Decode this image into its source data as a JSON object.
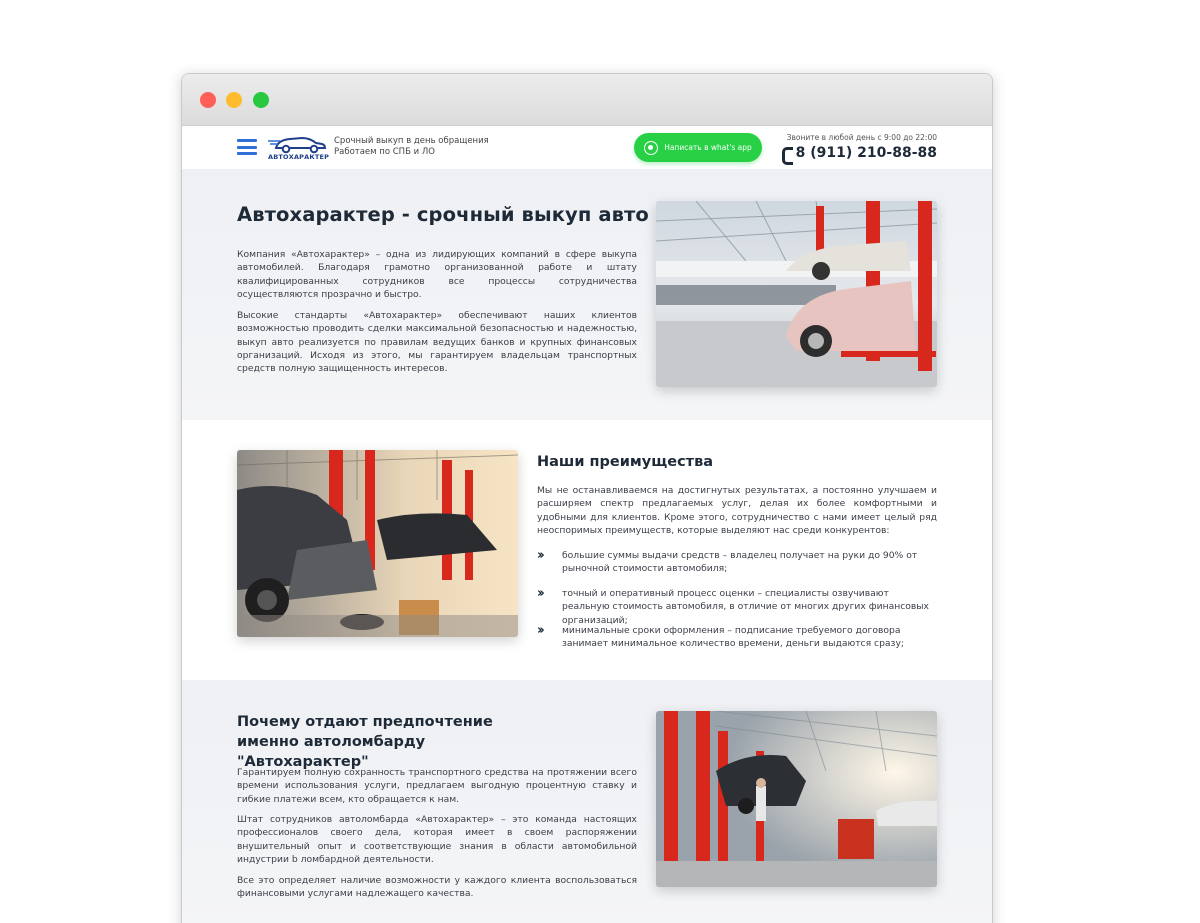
{
  "window": {
    "controls": [
      "close",
      "minimize",
      "maximize"
    ]
  },
  "header": {
    "logo_text": "АВТОХАРАКТЕР",
    "tagline_1": "Срочный выкуп в день обращения",
    "tagline_2": "Работаем по СПБ и ЛО",
    "whatsapp_label": "Написать в what's app",
    "call_note": "Звоните в любой день с 9:00 до 22:00",
    "phone": "8 (911) 210-88-88"
  },
  "hero": {
    "title": "Автохарактер - срочный выкуп авто",
    "p1": "Компания «Автохарактер» – одна из лидирующих компаний в сфере выкупа автомобилей. Благодаря грамотно организованной работе и штату квалифицированных сотрудников все процессы сотрудничества осуществляются прозрачно и быстро.",
    "p2": "Высокие стандарты «Автохарактер» обеспечивают наших клиентов возможностью проводить сделки максимальной безопасностью и надежностью, выкуп авто реализуется по правилам ведущих банков и крупных финансовых организаций. Исходя из этого, мы гарантируем владельцам транспортных средств полную защищенность интересов."
  },
  "advantages": {
    "title": "Наши преимущества",
    "intro": "Мы не останавливаемся на достигнутых результатах, а постоянно улучшаем и расширяем спектр предлагаемых услуг, делая их более комфортными и удобными для клиентов. Кроме этого, сотрудничество с нами имеет целый ряд неоспоримых преимуществ, которые выделяют нас среди конкурентов:",
    "items": [
      "большие суммы выдачи средств – владелец получает на руки до 90% от рыночной стоимости автомобиля;",
      "точный и оперативный процесс оценки – специалисты озвучивают реальную стоимость автомобиля, в отличие от многих других финансовых организаций;",
      "минимальные сроки оформления – подписание требуемого договора занимает минимальное количество времени, деньги выдаются сразу;"
    ]
  },
  "why": {
    "title": "Почему отдают предпочтение именно автоломбарду \"Автохарактер\"",
    "p1": "Гарантируем полную сохранность транспортного средства на протяжении всего времени использования услуги, предлагаем выгодную процентную ставку и гибкие платежи всем, кто обращается к нам.",
    "p2": "Штат сотрудников автоломбарда «Автохарактер» – это команда настоящих профессионалов своего дела, которая имеет в своем распоряжении внушительный опыт и соответствующие знания в области автомобильной индустрии b ломбардной деятельности.",
    "p3": "Все это определяет наличие возможности у каждого клиента воспользоваться финансовыми услугами надлежащего качества."
  },
  "colors": {
    "accent_blue": "#2f6fd6",
    "whatsapp_green": "#27d045",
    "lift_red": "#d8281e",
    "heading": "#1e2a38"
  }
}
